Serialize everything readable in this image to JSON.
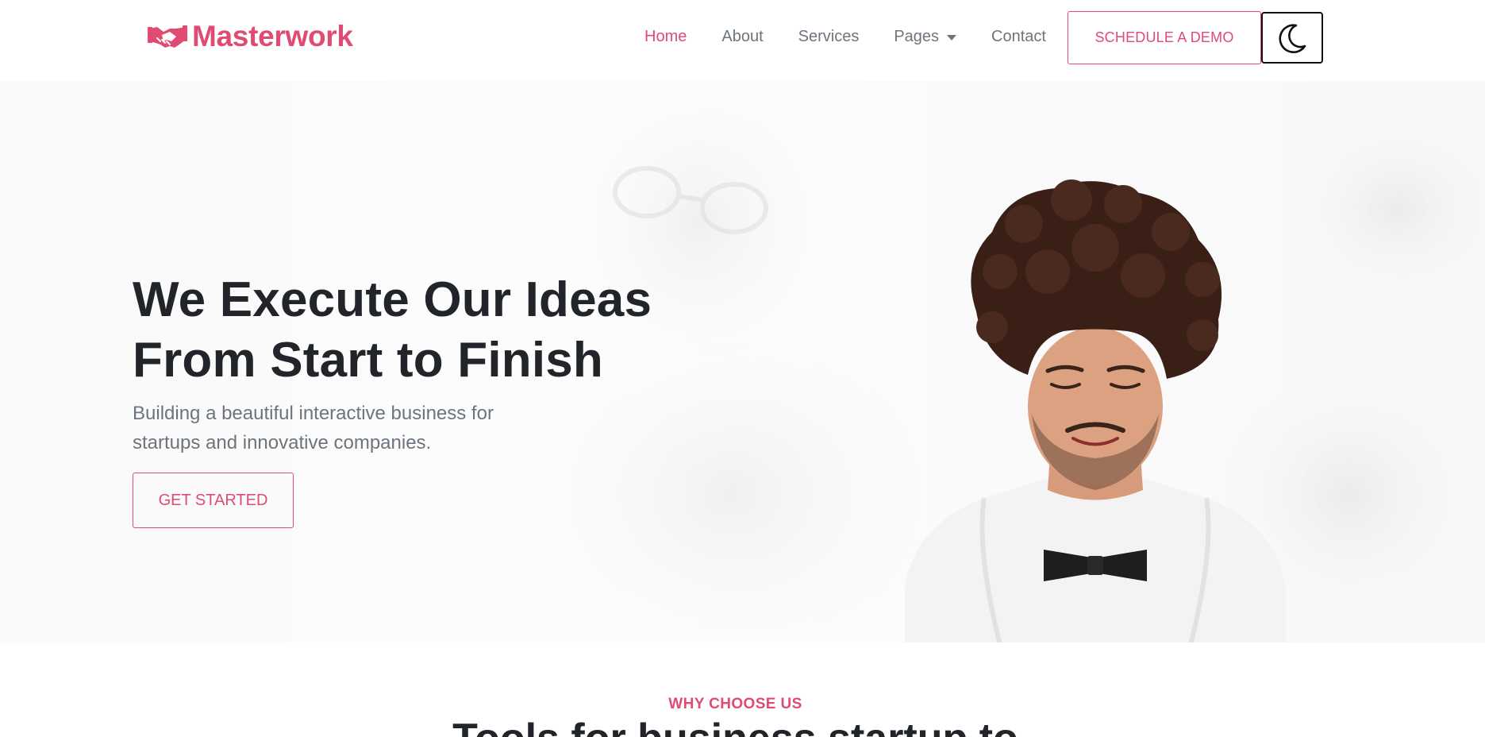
{
  "brand": {
    "name": "Masterwork",
    "icon": "handshake-icon",
    "color": "#e04b74"
  },
  "nav": {
    "links": [
      {
        "label": "Home",
        "active": true
      },
      {
        "label": "About",
        "active": false
      },
      {
        "label": "Services",
        "active": false
      },
      {
        "label": "Pages",
        "active": false,
        "has_dropdown": true
      },
      {
        "label": "Contact",
        "active": false
      }
    ],
    "cta_label": "SCHEDULE A DEMO",
    "theme_toggle_icon": "moon-icon"
  },
  "hero": {
    "title_line1": "We Execute Our Ideas",
    "title_line2": "From Start to Finish",
    "subtitle_line1": "Building a beautiful interactive business for",
    "subtitle_line2": "startups and innovative companies.",
    "button_label": "GET STARTED"
  },
  "why": {
    "eyebrow": "WHY CHOOSE US",
    "title": "Tools for business startup to"
  },
  "colors": {
    "accent": "#e04b74",
    "heading": "#212529",
    "muted": "#6c757d"
  }
}
